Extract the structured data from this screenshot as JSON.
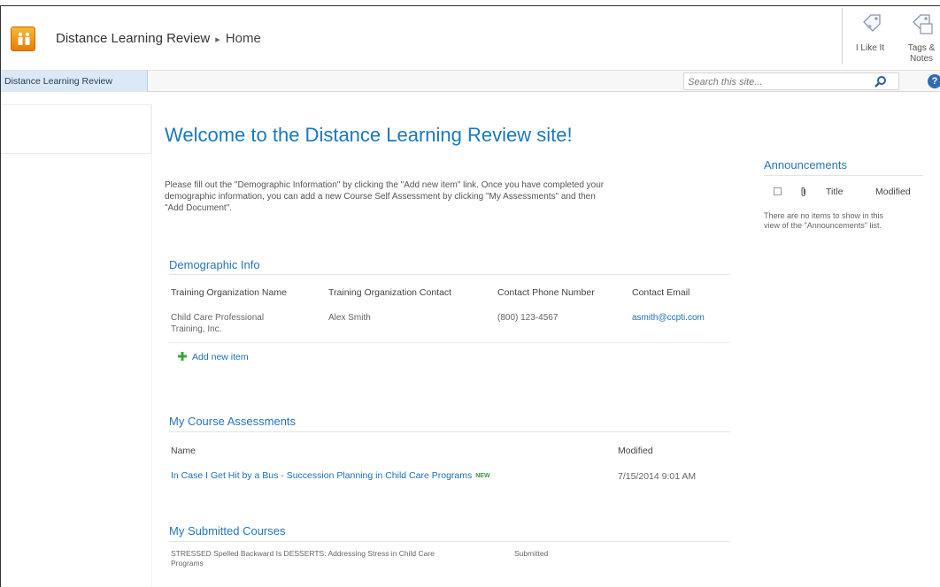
{
  "header": {
    "site_name": "Distance Learning Review",
    "breadcrumb_separator": "▸",
    "current_page": "Home",
    "ribbon": {
      "like_label": "I Like It",
      "tags_label_line1": "Tags &",
      "tags_label_line2": "Notes"
    }
  },
  "nav": {
    "home_tab": "Distance Learning Review",
    "search_placeholder": "Search this site...",
    "help_label": "?"
  },
  "main": {
    "welcome": "Welcome to the Distance Learning Review site!",
    "intro_line1": "Please fill out the \"Demographic Information\" by clicking the \"Add new item\" link.  Once you have completed your",
    "intro_line2": "demographic information, you can add a new Course Self Assessment by clicking \"My Assessments\" and then",
    "intro_line3": "\"Add Document\".",
    "demographic": {
      "title": "Demographic Info",
      "columns": [
        "Training Organization Name",
        "Training Organization Contact",
        "Contact Phone Number",
        "Contact Email"
      ],
      "rows": [
        {
          "org_name_line1": "Child Care Professional",
          "org_name_line2": "Training, Inc.",
          "contact": "Alex Smith",
          "phone": "(800) 123-4567",
          "email": "asmith@ccpti.com"
        }
      ],
      "add_new_label": "Add new item"
    },
    "assessments": {
      "title": "My Course Assessments",
      "columns": [
        "Name",
        "Modified"
      ],
      "rows": [
        {
          "name": "In Case I Get Hit by a Bus - Succession Planning in Child Care Programs",
          "badge": "NEW",
          "modified": "7/15/2014 9:01 AM"
        }
      ]
    },
    "submitted": {
      "title": "My Submitted Courses",
      "rows": [
        {
          "name_line1": "STRESSED Spelled Backward Is DESSERTS: Addressing Stress in Child Care",
          "name_line2": "Programs",
          "status": "Submitted"
        }
      ]
    }
  },
  "announcements": {
    "title": "Announcements",
    "columns": [
      "Title",
      "Modified"
    ],
    "empty_line1": "There are no items to show in this",
    "empty_line2": "view of the \"Announcements\" list."
  },
  "colors": {
    "link": "#1b6fb8",
    "heading": "#2476be",
    "logo": "#f39c12",
    "nav_selected": "#dbe8f6"
  }
}
